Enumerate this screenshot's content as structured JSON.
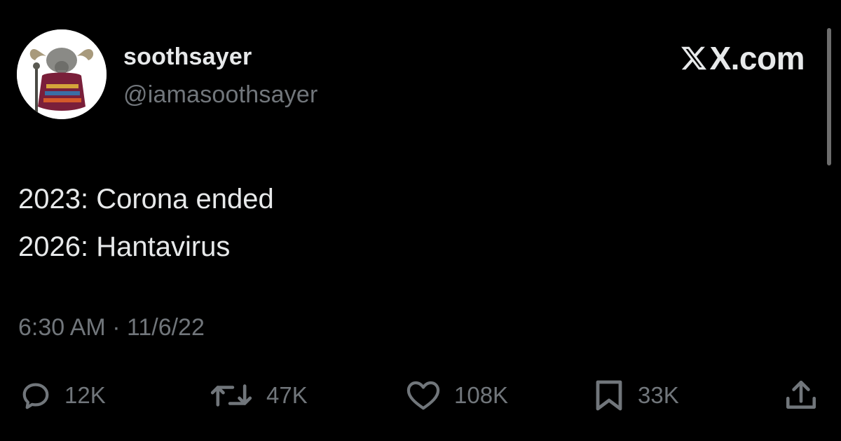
{
  "user": {
    "display_name": "soothsayer",
    "handle": "@iamasoothsayer"
  },
  "brand": {
    "text": "X.com",
    "logo_icon": "x-logo-icon"
  },
  "tweet": {
    "lines": [
      "2023: Corona ended",
      "2026: Hantavirus"
    ],
    "timestamp": "6:30 AM · 11/6/22"
  },
  "actions": {
    "reply": {
      "icon": "reply-icon",
      "count": "12K"
    },
    "repost": {
      "icon": "repost-icon",
      "count": "47K"
    },
    "like": {
      "icon": "heart-icon",
      "count": "108K"
    },
    "bookmark": {
      "icon": "bookmark-icon",
      "count": "33K"
    },
    "share": {
      "icon": "share-icon"
    }
  },
  "colors": {
    "background": "#000000",
    "primary_text": "#e7e9ea",
    "secondary_text": "#71767b"
  }
}
